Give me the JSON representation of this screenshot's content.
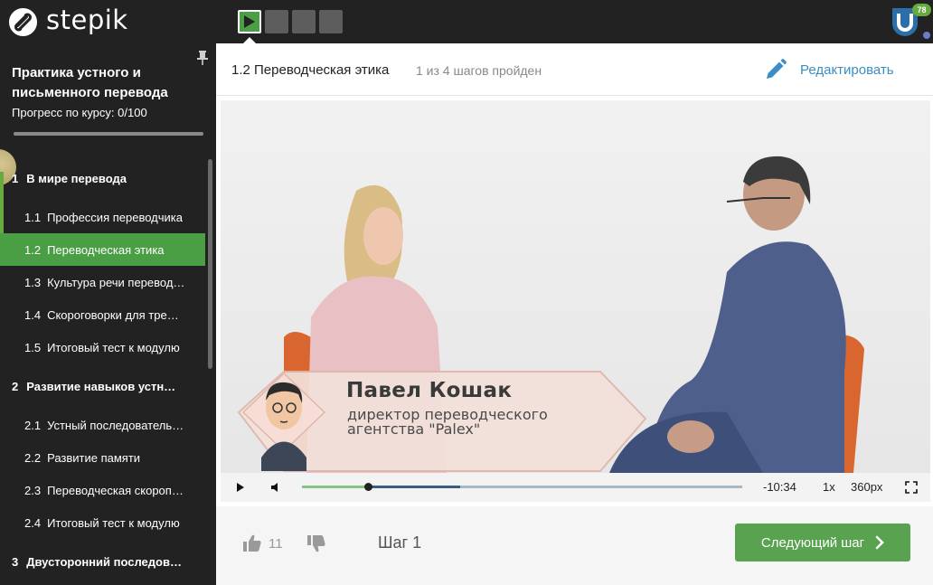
{
  "topbar": {
    "logo_text": "stepik",
    "step_count": 4,
    "active_step": 0,
    "notifications_badge": "78"
  },
  "sidebar": {
    "course_title": "Практика устного и письменного перевода",
    "progress_text": "Прогресс по курсу:  0/100",
    "progress_fraction": 0,
    "items": [
      {
        "type": "module",
        "num": "1",
        "label": "В мире перевода",
        "active": false
      },
      {
        "type": "lesson",
        "num": "1.1",
        "label": "Профессия переводчика",
        "active": false
      },
      {
        "type": "lesson",
        "num": "1.2",
        "label": "Переводческая этика",
        "active": true
      },
      {
        "type": "lesson",
        "num": "1.3",
        "label": "Культура речи перевод…",
        "active": false
      },
      {
        "type": "lesson",
        "num": "1.4",
        "label": "Скороговорки для тре…",
        "active": false
      },
      {
        "type": "lesson",
        "num": "1.5",
        "label": "Итоговый тест к модулю",
        "active": false
      },
      {
        "type": "module",
        "num": "2",
        "label": "Развитие навыков устн…",
        "active": false
      },
      {
        "type": "lesson",
        "num": "2.1",
        "label": "Устный последователь…",
        "active": false
      },
      {
        "type": "lesson",
        "num": "2.2",
        "label": "Развитие памяти",
        "active": false
      },
      {
        "type": "lesson",
        "num": "2.3",
        "label": "Переводческая скороп…",
        "active": false
      },
      {
        "type": "lesson",
        "num": "2.4",
        "label": "Итоговый тест к модулю",
        "active": false
      },
      {
        "type": "module",
        "num": "3",
        "label": "Двусторонний последов…",
        "active": false
      }
    ]
  },
  "header": {
    "lesson_title": "1.2 Переводческая этика",
    "steps_passed": "1 из 4 шагов пройден",
    "edit_label": "Редактировать"
  },
  "video": {
    "lower_third_name": "Павел Кошак",
    "lower_third_role": "директор переводческого агентства \"Palex\"",
    "time_remaining": "-10:34",
    "speed": "1x",
    "quality": "360px",
    "played_fraction": 0.15,
    "buffered_fraction": 0.36
  },
  "footer": {
    "likes": "11",
    "step_label": "Шаг 1",
    "next_label": "Следующий шаг"
  },
  "colors": {
    "accent_green": "#59a24f",
    "sidebar_bg": "#222222",
    "link_blue": "#3c8dc3"
  }
}
